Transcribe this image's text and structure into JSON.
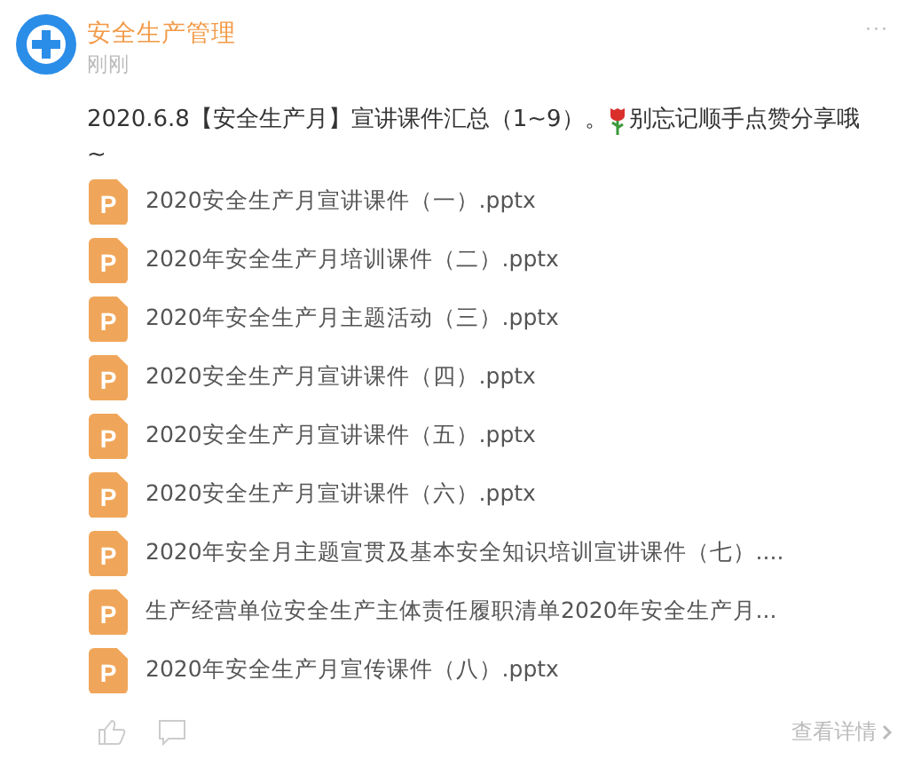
{
  "post": {
    "author": "安全生产管理",
    "time": "刚刚",
    "more": "···",
    "text_before": "2020.6.8【安全生产月】宣讲课件汇总（1~9）。",
    "text_after": "别忘记顺手点赞分享哦",
    "text_end": "~"
  },
  "files": [
    {
      "badge": "P",
      "name": "2020安全生产月宣讲课件（一）.pptx"
    },
    {
      "badge": "P",
      "name": "2020年安全生产月培训课件（二）.pptx"
    },
    {
      "badge": "P",
      "name": "2020年安全生产月主题活动（三）.pptx"
    },
    {
      "badge": "P",
      "name": "2020安全生产月宣讲课件（四）.pptx"
    },
    {
      "badge": "P",
      "name": "2020安全生产月宣讲课件（五）.pptx"
    },
    {
      "badge": "P",
      "name": "2020安全生产月宣讲课件（六）.pptx"
    },
    {
      "badge": "P",
      "name": "2020年安全月主题宣贯及基本安全知识培训宣讲课件（七）...."
    },
    {
      "badge": "P",
      "name": "生产经营单位安全生产主体责任履职清单2020年安全生产月..."
    },
    {
      "badge": "P",
      "name": "2020年安全生产月宣传课件（八）.pptx"
    }
  ],
  "footer": {
    "details": "查看详情"
  }
}
